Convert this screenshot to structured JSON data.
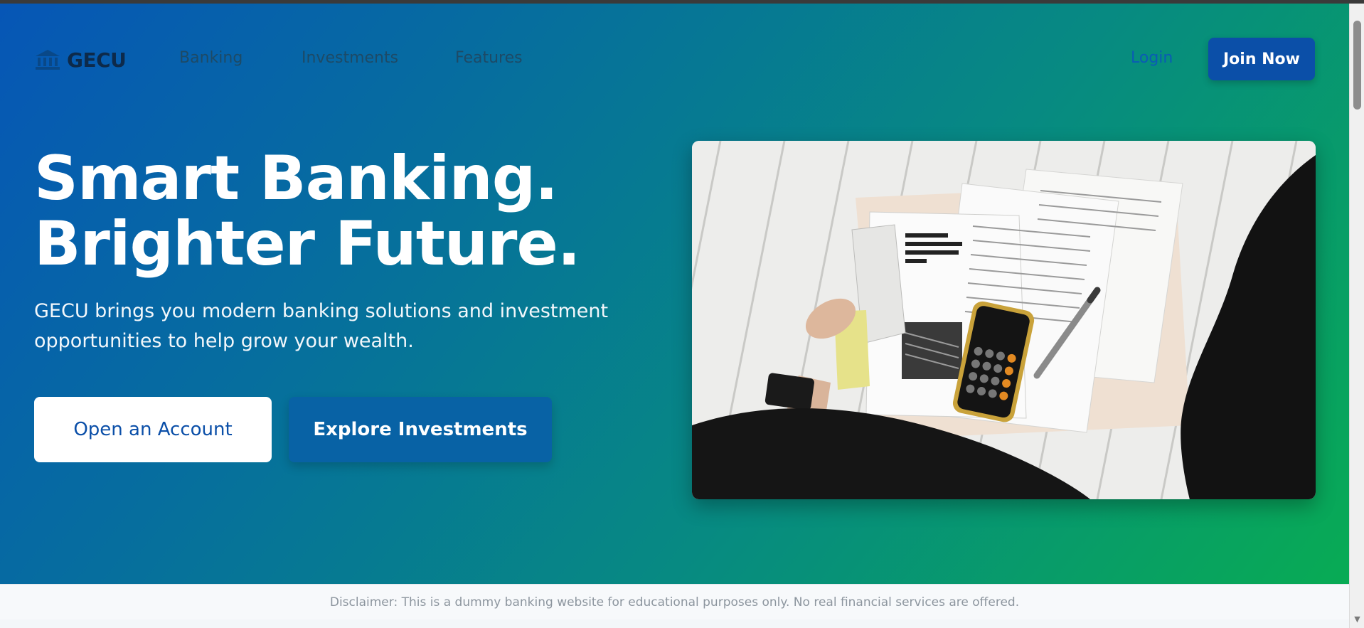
{
  "brand": {
    "name": "GECU",
    "logo_icon": "bank-logo-icon"
  },
  "nav": {
    "links": [
      "Banking",
      "Investments",
      "Features"
    ],
    "login": "Login",
    "join": "Join Now"
  },
  "hero": {
    "headline_line1": "Smart Banking.",
    "headline_line2": "Brighter Future.",
    "subtext": "GECU brings you modern banking solutions and investment opportunities to help grow your wealth.",
    "primary_cta": "Open an Account",
    "secondary_cta": "Explore Investments",
    "image_alt": "hero-photo"
  },
  "footer": {
    "disclaimer": "Disclaimer: This is a dummy banking website for educational purposes only. No real financial services are offered."
  },
  "colors": {
    "gradient_start": "#0656b6",
    "gradient_end": "#08ab54",
    "primary_button": "#0b4fa8",
    "accent": "#0862a5"
  }
}
